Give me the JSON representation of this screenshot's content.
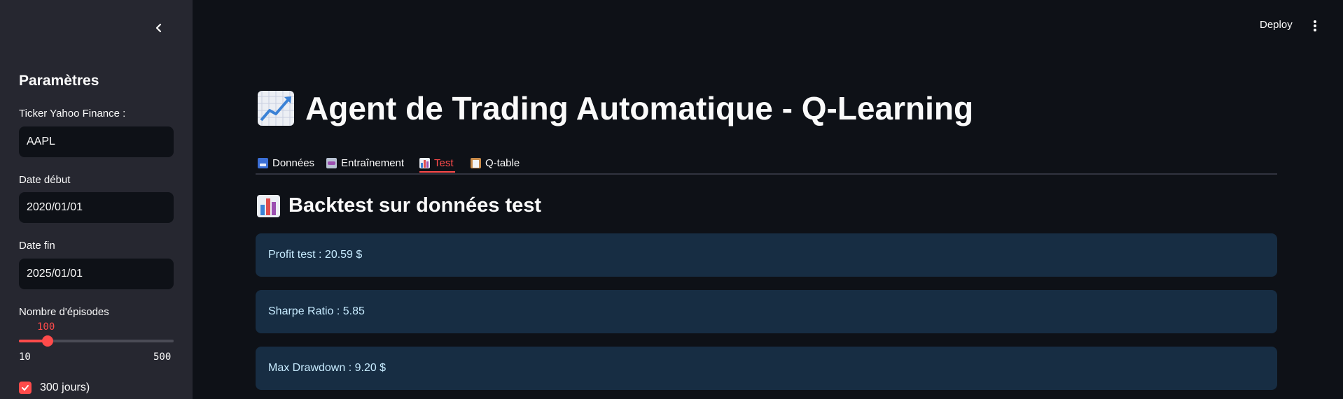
{
  "sidebar": {
    "title": "Paramètres",
    "ticker": {
      "label": "Ticker Yahoo Finance :",
      "value": "AAPL"
    },
    "date_start": {
      "label": "Date début",
      "value": "2020/01/01"
    },
    "date_end": {
      "label": "Date fin",
      "value": "2025/01/01"
    },
    "episodes": {
      "label": "Nombre d'épisodes",
      "value": "100",
      "min": "10",
      "max": "500",
      "fraction": 0.184
    },
    "checkbox": {
      "label": "300 jours)",
      "checked": true
    }
  },
  "topbar": {
    "deploy_label": "Deploy"
  },
  "main": {
    "title": "Agent de Trading Automatique - Q-Learning",
    "tabs": [
      {
        "label": "Données",
        "icon": "inbox-tray-icon"
      },
      {
        "label": "Entraînement",
        "icon": "robot-icon"
      },
      {
        "label": "Test",
        "icon": "bar-chart-icon",
        "active": true
      },
      {
        "label": "Q-table",
        "icon": "clipboard-icon"
      }
    ],
    "section_title": "Backtest sur données test",
    "metrics": [
      "Profit test : 20.59 $",
      "Sharpe Ratio : 5.85",
      "Max Drawdown : 9.20 $"
    ]
  },
  "colors": {
    "accent": "#ff4b4b",
    "sidebar_bg": "#262730",
    "main_bg": "#0e1117",
    "info_bg": "#172d43",
    "info_text": "#c7ebff"
  }
}
